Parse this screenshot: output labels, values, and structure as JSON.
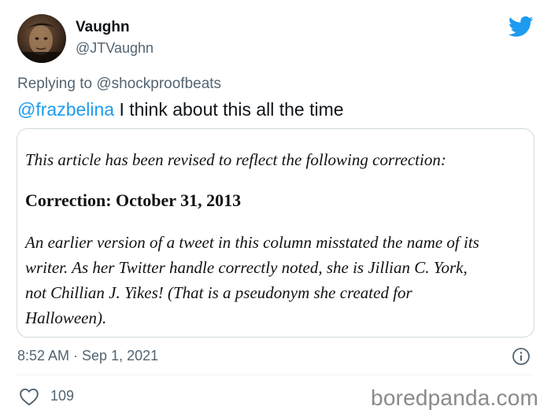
{
  "author": {
    "display_name": "Vaughn",
    "handle": "@JTVaughn",
    "avatar_icon": "profile-photo"
  },
  "reply": {
    "prefix": "Replying to",
    "to_handle": "@shockproofbeats"
  },
  "tweet": {
    "mention": "@frazbelina",
    "text": "I think about this all the time"
  },
  "media": {
    "intro": "This article has been revised to reflect the following correction:",
    "heading": "Correction: October 31, 2013",
    "body_lines": [
      "An earlier version of a tweet in this column misstated the name of its",
      "writer. As her Twitter handle correctly noted, she is Jillian C. York,",
      "not Chillian J. Yikes! (That is a pseudonym she created for",
      "Halloween)."
    ]
  },
  "meta": {
    "timestamp": "8:52 AM · Sep 1, 2021"
  },
  "engagement": {
    "likes": "109"
  },
  "watermark": "boredpanda.com",
  "colors": {
    "twitter_blue": "#1d9bf0",
    "secondary_text": "#536471",
    "border": "#cfd9de"
  }
}
